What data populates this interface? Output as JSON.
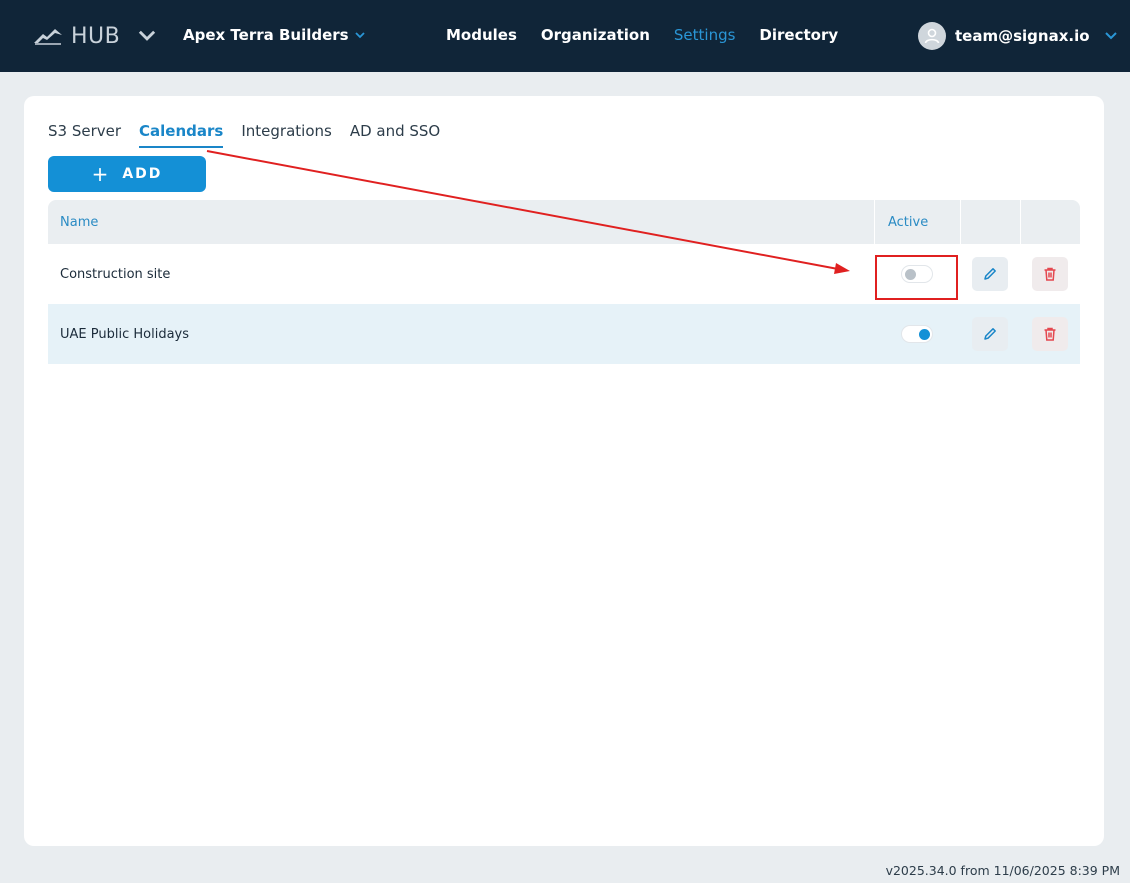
{
  "app": {
    "logo_text": "HUB"
  },
  "header": {
    "org_name": "Apex Terra Builders",
    "nav": [
      "Modules",
      "Organization",
      "Settings",
      "Directory"
    ],
    "active_nav": "Settings",
    "user_email": "team@signax.io"
  },
  "tabs": [
    "S3 Server",
    "Calendars",
    "Integrations",
    "AD and SSO"
  ],
  "active_tab": "Calendars",
  "add_button": {
    "label": "ADD"
  },
  "table": {
    "columns": {
      "name": "Name",
      "active": "Active"
    },
    "rows": [
      {
        "name": "Construction site",
        "active": false
      },
      {
        "name": "UAE Public Holidays",
        "active": true
      }
    ]
  },
  "footer": {
    "version": "v2025.34.0 from 11/06/2025 8:39 PM"
  },
  "colors": {
    "topbar": "#102538",
    "accent": "#1490d6",
    "annotation": "#e02020",
    "delete": "#e4474f"
  },
  "icons": [
    "logo-icon",
    "chevron-down-icon",
    "user-avatar-icon",
    "plus-icon",
    "pencil-icon",
    "trash-icon"
  ]
}
